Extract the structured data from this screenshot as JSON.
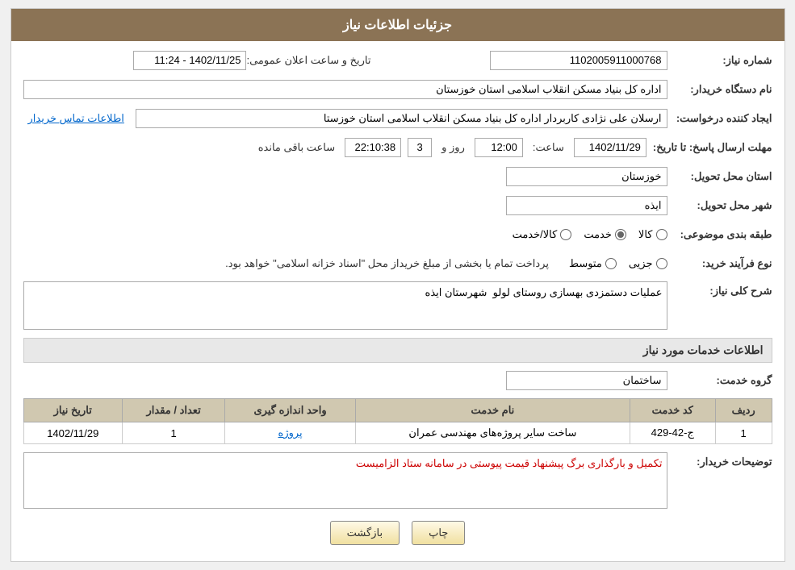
{
  "page": {
    "title": "جزئیات اطلاعات نیاز"
  },
  "fields": {
    "need_number_label": "شماره نیاز:",
    "need_number_value": "1102005911000768",
    "announce_label": "تاریخ و ساعت اعلان عمومی:",
    "announce_value": "1402/11/25 - 11:24",
    "requester_label": "نام دستگاه خریدار:",
    "requester_value": "اداره کل بنیاد مسکن انقلاب اسلامی استان خوزستان",
    "creator_label": "ایجاد کننده درخواست:",
    "creator_value": "ارسلان علی نژادی کاربردار اداره کل بنیاد مسکن انقلاب اسلامی استان خوزستا",
    "contact_link": "اطلاعات تماس خریدار",
    "deadline_label": "مهلت ارسال پاسخ: تا تاریخ:",
    "deadline_date": "1402/11/29",
    "deadline_time_label": "ساعت:",
    "deadline_time": "12:00",
    "deadline_day_label": "روز و",
    "deadline_remaining": "3",
    "deadline_hour_label": "ساعت باقی مانده",
    "deadline_clock": "22:10:38",
    "province_label": "استان محل تحویل:",
    "province_value": "خوزستان",
    "city_label": "شهر محل تحویل:",
    "city_value": "ایذه",
    "category_label": "طبقه بندی موضوعی:",
    "category_options": [
      "کالا",
      "خدمت",
      "کالا/خدمت"
    ],
    "category_selected": "خدمت",
    "purchase_type_label": "نوع فرآیند خرید:",
    "purchase_options": [
      "جزیی",
      "متوسط"
    ],
    "purchase_description": "پرداخت تمام یا بخشی از مبلغ خریداز محل \"اسناد خزانه اسلامی\" خواهد بود.",
    "description_label": "شرح کلی نیاز:",
    "description_value": "عملیات دستمزدی بهسازی روستای لولو  شهرستان ایذه",
    "services_section": "اطلاعات خدمات مورد نیاز",
    "service_group_label": "گروه خدمت:",
    "service_group_value": "ساختمان",
    "table": {
      "headers": [
        "ردیف",
        "کد خدمت",
        "نام خدمت",
        "واحد اندازه گیری",
        "تعداد / مقدار",
        "تاریخ نیاز"
      ],
      "rows": [
        {
          "row": "1",
          "code": "ج-42-429",
          "name": "ساخت سایر پروژه‌های مهندسی عمران",
          "unit": "پروژه",
          "count": "1",
          "date": "1402/11/29"
        }
      ]
    },
    "buyer_notes_label": "توضیحات خریدار:",
    "buyer_notes_value": "تکمیل و بارگذاری برگ پیشنهاد قیمت پیوستی در سامانه ستاد الزامیست",
    "btn_print": "چاپ",
    "btn_back": "بازگشت"
  }
}
